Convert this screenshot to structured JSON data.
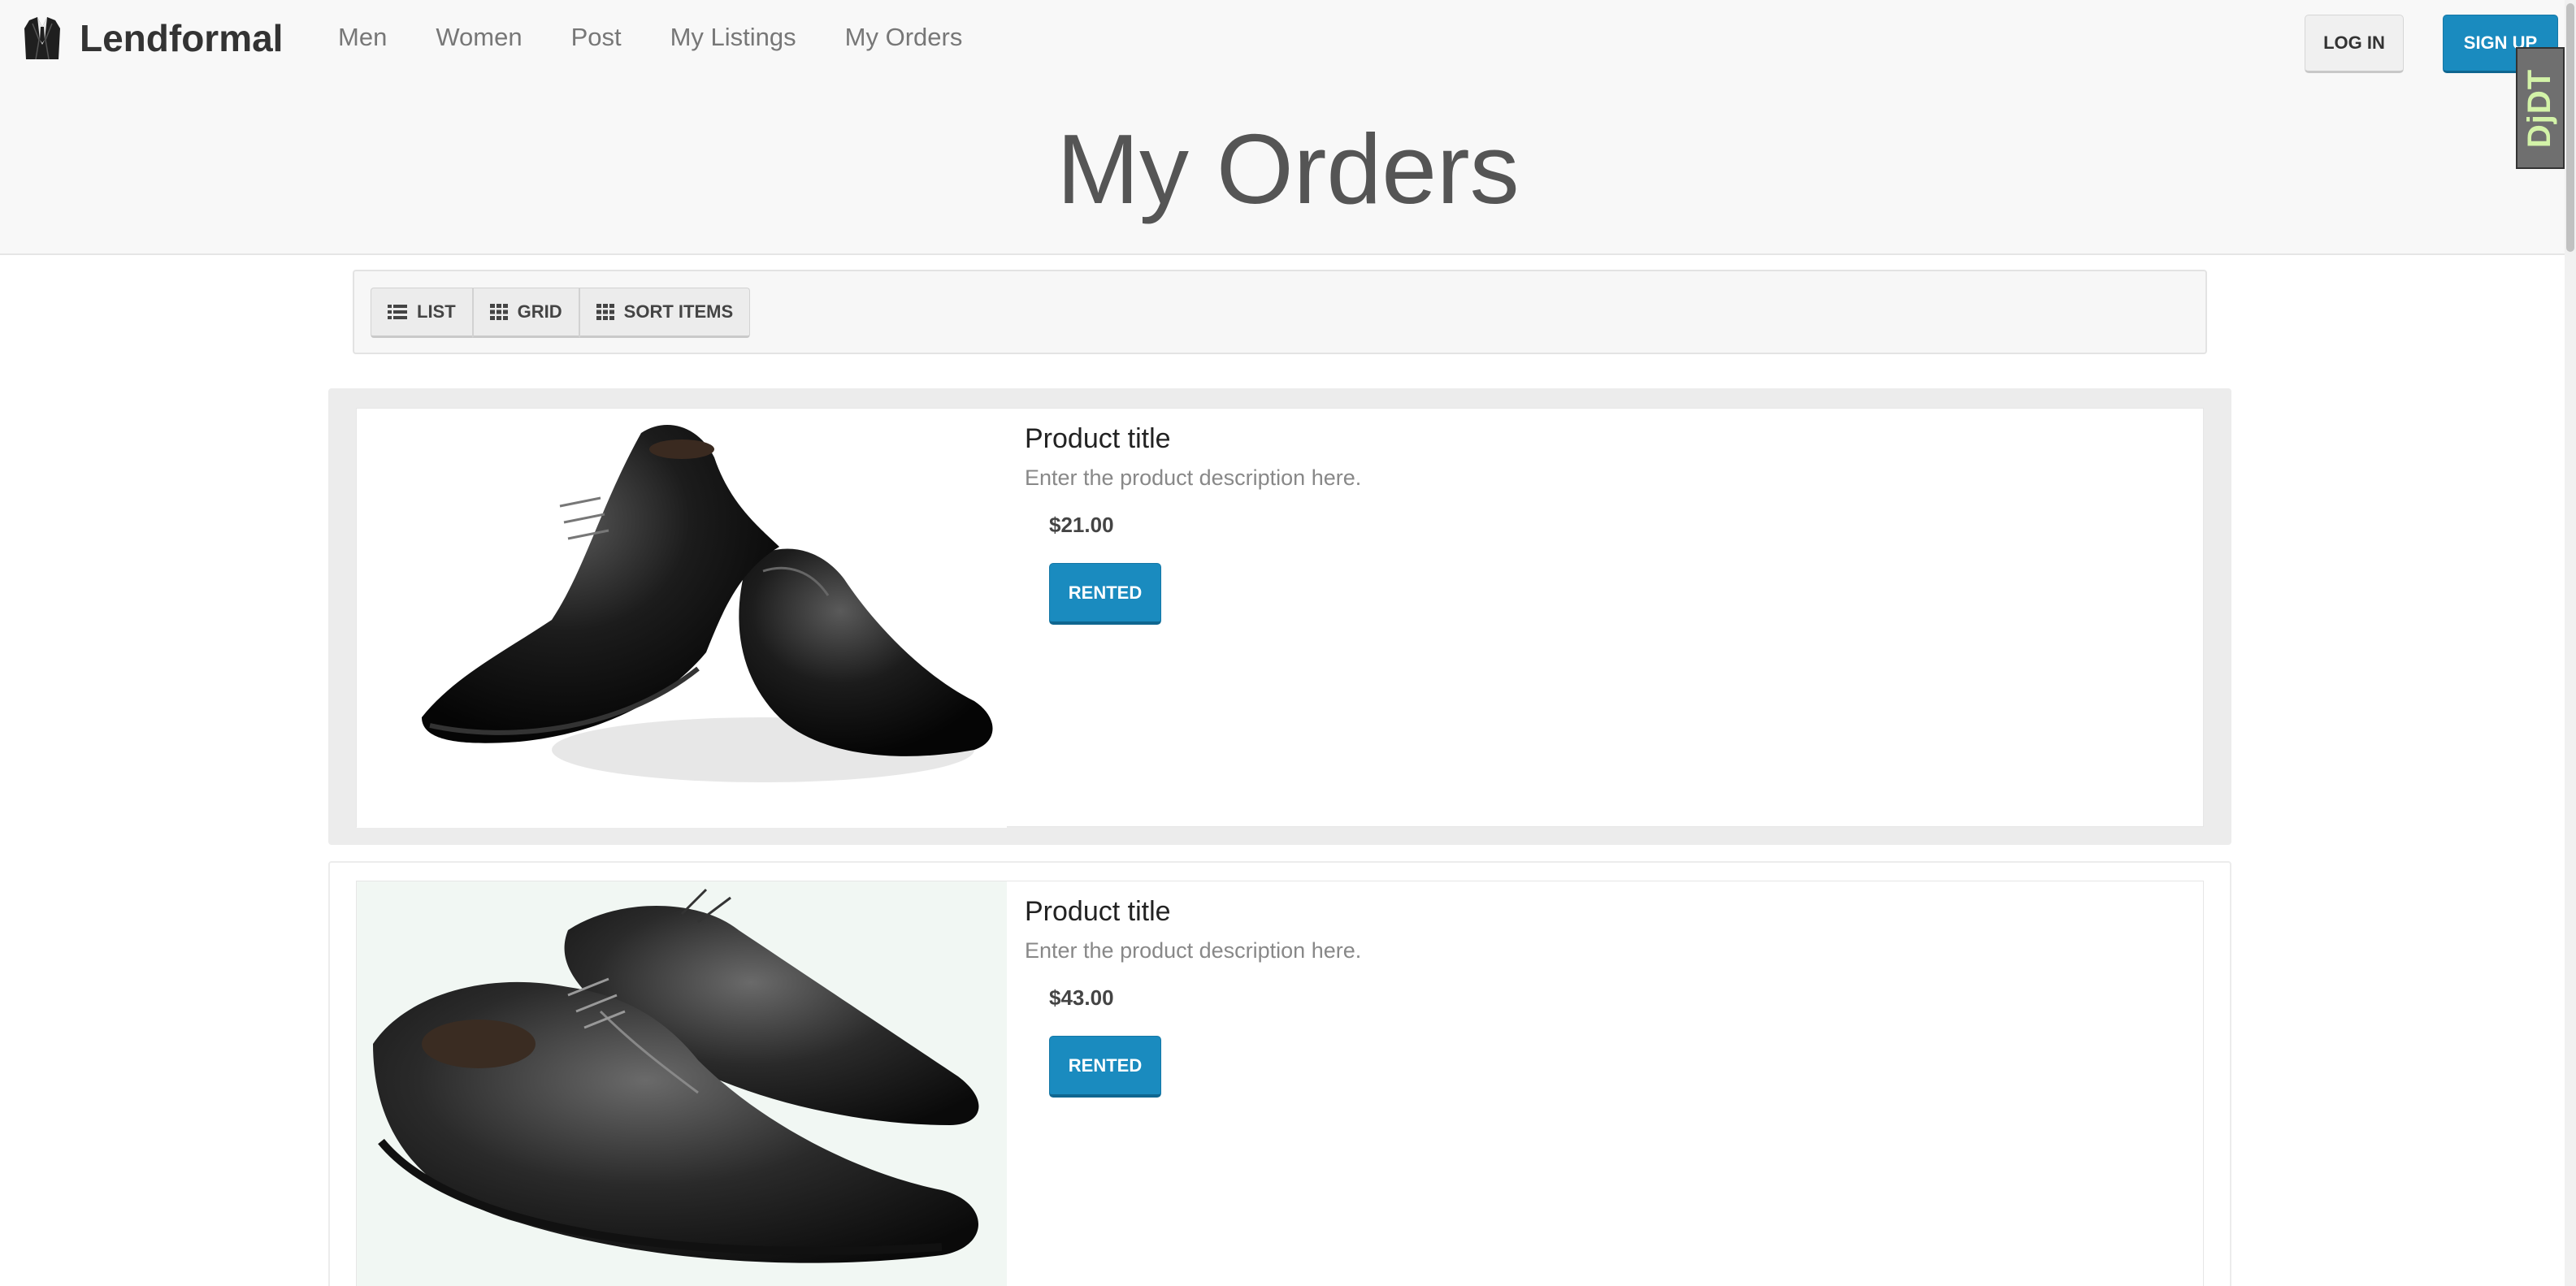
{
  "brand": {
    "name": "Lendformal",
    "logo_icon": "suit-jacket-icon"
  },
  "nav": {
    "links": [
      {
        "label": "Men"
      },
      {
        "label": "Women"
      },
      {
        "label": "Post"
      },
      {
        "label": "My Listings"
      },
      {
        "label": "My Orders"
      }
    ],
    "login_label": "LOG IN",
    "signup_label": "SIGN UP"
  },
  "debug_badge": {
    "label": "DjDT"
  },
  "page": {
    "title": "My Orders"
  },
  "toolbar": {
    "buttons": [
      {
        "label": "LIST",
        "icon": "list-icon"
      },
      {
        "label": "GRID",
        "icon": "grid-icon"
      },
      {
        "label": "SORT ITEMS",
        "icon": "grid-icon"
      }
    ]
  },
  "products": [
    {
      "title": "Product title",
      "description": "Enter the product description here.",
      "price": "$21.00",
      "status_label": "RENTED",
      "image": "black-oxford-shoes-image"
    },
    {
      "title": "Product title",
      "description": "Enter the product description here.",
      "price": "$43.00",
      "status_label": "RENTED",
      "image": "black-loafer-shoes-image"
    }
  ],
  "colors": {
    "accent": "#1a8bbf",
    "header_bg": "#f8f8f8",
    "card_bg": "#ececec"
  }
}
